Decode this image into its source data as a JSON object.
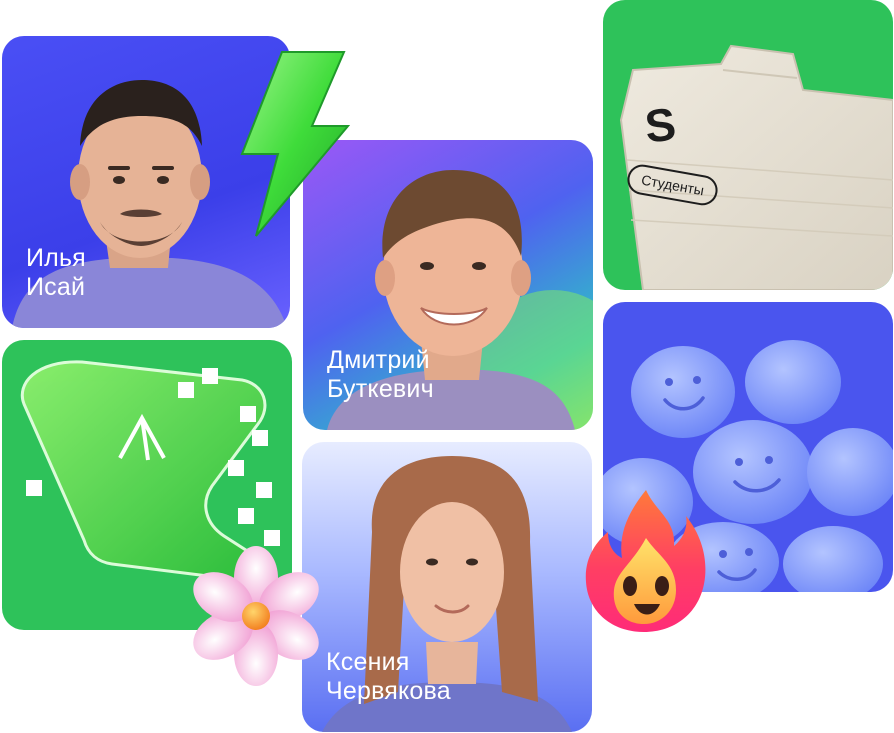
{
  "speakers": [
    {
      "name": "Илья\nИсай"
    },
    {
      "name": "Дмитрий\nБуткевич"
    },
    {
      "name": "Ксения\nЧервякова"
    }
  ],
  "students_card": {
    "letter": "S",
    "label": "Студенты"
  },
  "icons": [
    "lightning-bolt-icon",
    "arrow-cursor-icon",
    "flower-icon",
    "fire-emoji-icon",
    "smiley-tablets"
  ],
  "colors": {
    "green": "#2ec25a",
    "blue": "#4a4ff5",
    "white": "#ffffff"
  }
}
